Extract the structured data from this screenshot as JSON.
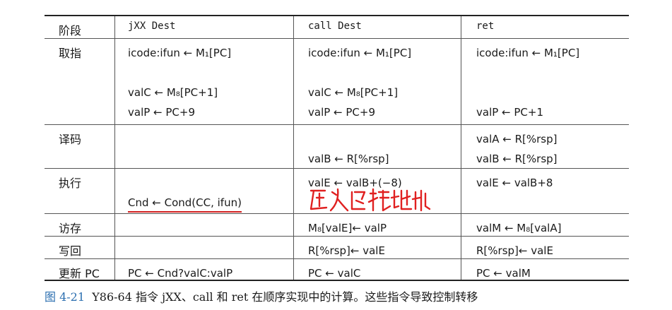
{
  "table": {
    "header": [
      "阶段",
      "jXX Dest",
      "call Dest",
      "ret"
    ],
    "rows": [
      {
        "stage": "取指",
        "jxx": [
          "icode:ifun ← M₁[PC]",
          "",
          "valC ← M₈[PC+1]",
          "valP ← PC+9"
        ],
        "call": [
          "icode:ifun ← M₁[PC]",
          "",
          "valC ← M₈[PC+1]",
          "valP ← PC+9"
        ],
        "ret": [
          "icode:ifun ← M₁[PC]",
          "",
          "",
          "valP ← PC+1"
        ]
      },
      {
        "stage": "译码",
        "jxx": [
          "",
          ""
        ],
        "call": [
          "",
          "valB ← R[%rsp]"
        ],
        "ret": [
          "valA ← R[%rsp]",
          "valB ← R[%rsp]"
        ]
      },
      {
        "stage": "执行",
        "jxx": [
          "",
          "Cnd ← Cond(CC, ifun)"
        ],
        "call": [
          "valE ← valB+(−8)",
          ""
        ],
        "ret": [
          "valE ← valB+8",
          ""
        ]
      },
      {
        "stage": "访存",
        "jxx": [
          ""
        ],
        "call": [
          "M₈[valE]← valP"
        ],
        "ret": [
          "valM ← M₈[valA]"
        ]
      },
      {
        "stage": "写回",
        "jxx": [
          ""
        ],
        "call": [
          "R[%rsp]← valE"
        ],
        "ret": [
          "R[%rsp]← valE"
        ]
      },
      {
        "stage": "更新 PC",
        "jxx": [
          "PC ← Cnd?valC:valP"
        ],
        "call": [
          "PC ← valC"
        ],
        "ret": [
          "PC ← valM"
        ]
      }
    ]
  },
  "annotation": {
    "text": "压入函栈地址",
    "color": "#e02020"
  },
  "caption": {
    "number": "图 4-21",
    "text": "  Y86-64 指令 jXX、call 和 ret 在顺序实现中的计算。这些指令导致控制转移"
  }
}
